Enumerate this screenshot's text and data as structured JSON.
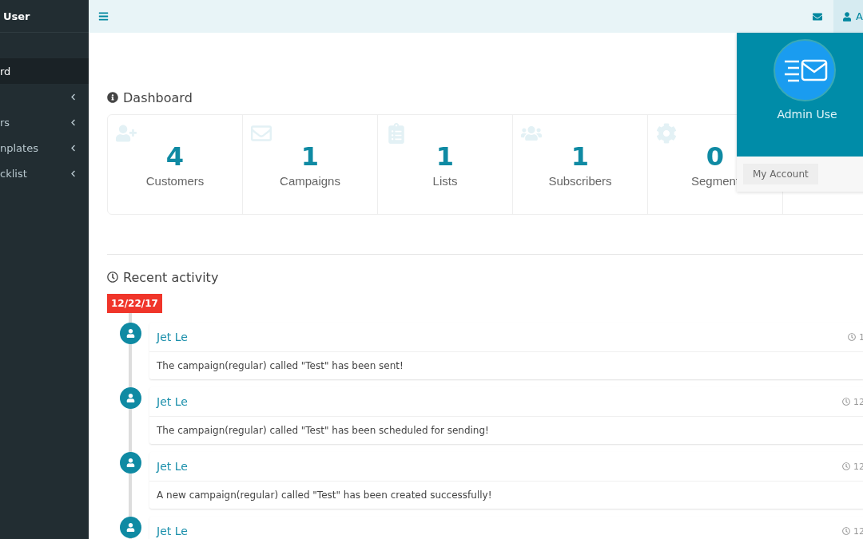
{
  "sidebar": {
    "user_name": "User",
    "items": [
      {
        "label": "rd",
        "selected": true,
        "has_submenu": false
      },
      {
        "selected": false,
        "has_submenu": true
      },
      {
        "label": "rs",
        "selected": false,
        "has_submenu": true
      },
      {
        "label": "nplates",
        "selected": false,
        "has_submenu": true
      },
      {
        "label": "cklist",
        "selected": false,
        "has_submenu": true
      }
    ]
  },
  "topbar": {
    "user_button": "A"
  },
  "user_dropdown": {
    "name": "Admin Use",
    "button": "My Account"
  },
  "dashboard": {
    "title": "Dashboard",
    "stats": [
      {
        "kind": "customers",
        "value": "4",
        "label": "Customers"
      },
      {
        "kind": "campaigns",
        "value": "1",
        "label": "Campaigns"
      },
      {
        "kind": "lists",
        "value": "1",
        "label": "Lists"
      },
      {
        "kind": "subscribers",
        "value": "1",
        "label": "Subscribers"
      },
      {
        "kind": "segments",
        "value": "0",
        "label": "Segment"
      }
    ]
  },
  "recent_activity": {
    "title": "Recent activity",
    "date": "12/22/17",
    "items": [
      {
        "author": "Jet Le",
        "time": "1",
        "message": "The campaign(regular) called \"Test\" has been sent!"
      },
      {
        "author": "Jet Le",
        "time": "12",
        "message": "The campaign(regular) called \"Test\" has been scheduled for sending!"
      },
      {
        "author": "Jet Le",
        "time": "12",
        "message": "A new campaign(regular) called \"Test\" has been created successfully!"
      },
      {
        "author": "Jet Le",
        "time": "12"
      }
    ]
  }
}
